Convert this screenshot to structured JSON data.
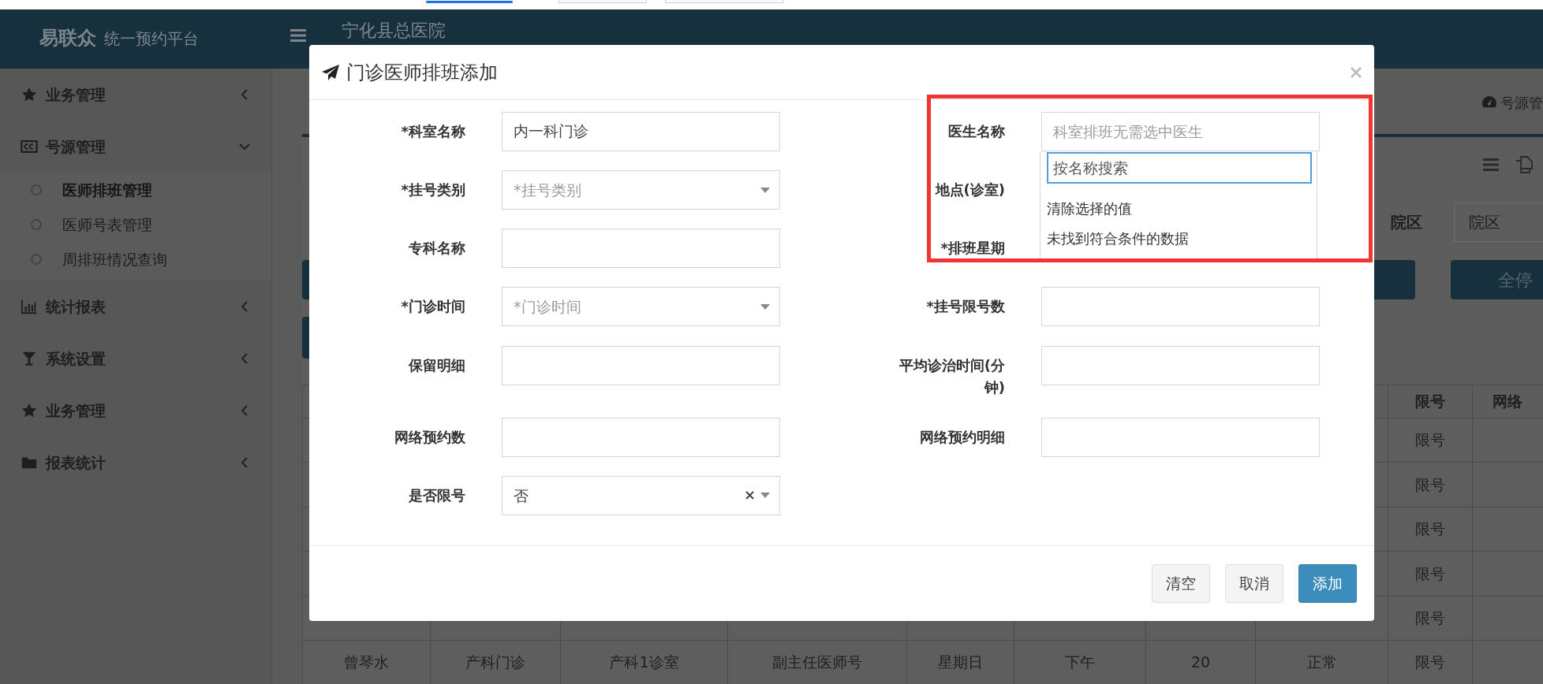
{
  "top_strip": {
    "tabs": [
      {
        "selected": true
      },
      {
        "selected": false
      },
      {
        "selected": false
      }
    ]
  },
  "header": {
    "brand": "易联众",
    "subtitle": "统一预约平台",
    "hospital": "宁化县总医院"
  },
  "sidebar": {
    "items": [
      {
        "label": "业务管理",
        "expanded": false
      },
      {
        "label": "号源管理",
        "expanded": true,
        "children": [
          {
            "label": "医师排班管理",
            "selected": true
          },
          {
            "label": "医师号表管理",
            "selected": false
          },
          {
            "label": "周排班情况查询",
            "selected": false
          }
        ]
      },
      {
        "label": "统计报表",
        "expanded": false
      },
      {
        "label": "系统设置",
        "expanded": false
      },
      {
        "label": "业务管理",
        "expanded": false
      },
      {
        "label": "报表统计",
        "expanded": false
      }
    ]
  },
  "breadcrumb": "号源管",
  "filter": {
    "label": "院区",
    "placeholder": "院区"
  },
  "stop_button": "全停",
  "table": {
    "columns": [
      null,
      null,
      null,
      null,
      null,
      null,
      null,
      null,
      "限号",
      "网络"
    ],
    "rows": [
      {
        "cells": [
          null,
          null,
          null,
          null,
          null,
          null,
          null,
          null,
          "限号",
          null
        ]
      },
      {
        "cells": [
          null,
          null,
          null,
          null,
          null,
          null,
          null,
          null,
          "限号",
          null
        ]
      },
      {
        "cells": [
          null,
          null,
          null,
          null,
          null,
          null,
          null,
          null,
          "限号",
          null
        ]
      },
      {
        "cells": [
          null,
          null,
          null,
          null,
          null,
          null,
          null,
          null,
          "限号",
          null
        ]
      },
      {
        "cells": [
          null,
          null,
          null,
          null,
          null,
          null,
          null,
          null,
          "限号",
          null
        ]
      },
      {
        "cells": [
          "曾琴水",
          "产科门诊",
          "产科1诊室",
          "副主任医师号",
          "星期日",
          "下午",
          "20",
          "正常",
          "限号",
          null
        ]
      }
    ]
  },
  "modal": {
    "title": "门诊医师排班添加",
    "rows": [
      {
        "left": {
          "label": "*科室名称",
          "kind": "text",
          "value": "内一科门诊"
        },
        "right": {
          "label": "医生名称",
          "kind": "text",
          "placeholder": "科室排班无需选中医生"
        }
      },
      {
        "left": {
          "label": "*挂号类别",
          "kind": "select",
          "placeholder": "*挂号类别"
        },
        "right": {
          "label": "地点(诊室)",
          "kind": "covered"
        }
      },
      {
        "left": {
          "label": "专科名称",
          "kind": "text"
        },
        "right": {
          "label": "*排班星期",
          "kind": "covered"
        }
      },
      {
        "left": {
          "label": "*门诊时间",
          "kind": "select",
          "placeholder": "*门诊时间"
        },
        "right": {
          "label": "*挂号限号数",
          "kind": "text"
        }
      },
      {
        "left": {
          "label": "保留明细",
          "kind": "text"
        },
        "right": {
          "label": "平均诊治时间(分钟)",
          "kind": "text"
        }
      },
      {
        "left": {
          "label": "网络预约数",
          "kind": "text"
        },
        "right": {
          "label": "网络预约明细",
          "kind": "text"
        }
      },
      {
        "left": {
          "label": "是否限号",
          "kind": "select",
          "value": "否",
          "clearable": true
        }
      }
    ],
    "dropdown": {
      "search_placeholder": "按名称搜索",
      "focused": true,
      "options": [
        "清除选择的值",
        "未找到符合条件的数据"
      ]
    },
    "buttons": [
      {
        "label": "清空",
        "kind": "default"
      },
      {
        "label": "取消",
        "kind": "default"
      },
      {
        "label": "添加",
        "kind": "primary"
      }
    ]
  },
  "annotation": {
    "kind": "frame"
  }
}
